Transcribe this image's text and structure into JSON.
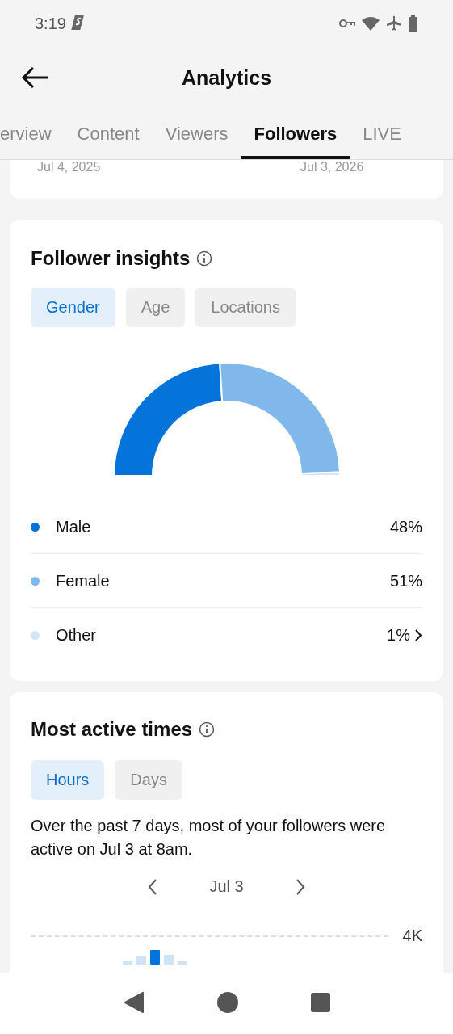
{
  "status_bar": {
    "time": "3:19"
  },
  "header": {
    "title": "Analytics"
  },
  "tabs": [
    {
      "label": "erview",
      "selected": false
    },
    {
      "label": "Content",
      "selected": false
    },
    {
      "label": "Viewers",
      "selected": false
    },
    {
      "label": "Followers",
      "selected": true
    },
    {
      "label": "LIVE",
      "selected": false
    }
  ],
  "date_range": {
    "start": "Jul 4, 2025",
    "end": "Jul 3, 2026"
  },
  "follower_insights": {
    "title": "Follower insights",
    "filters": [
      {
        "label": "Gender",
        "selected": true
      },
      {
        "label": "Age",
        "selected": false
      },
      {
        "label": "Locations",
        "selected": false
      }
    ],
    "legend": [
      {
        "label": "Male",
        "value": "48%",
        "color": "#0474db",
        "expandable": false
      },
      {
        "label": "Female",
        "value": "51%",
        "color": "#80b8ec",
        "expandable": false
      },
      {
        "label": "Other",
        "value": "1%",
        "color": "#d3e5f8",
        "expandable": true
      }
    ]
  },
  "active_times": {
    "title": "Most active times",
    "filters": [
      {
        "label": "Hours",
        "selected": true
      },
      {
        "label": "Days",
        "selected": false
      }
    ],
    "summary": "Over the past 7 days, most of your followers were active on Jul 3 at 8am.",
    "date": "Jul 3",
    "tick": "4K"
  }
}
